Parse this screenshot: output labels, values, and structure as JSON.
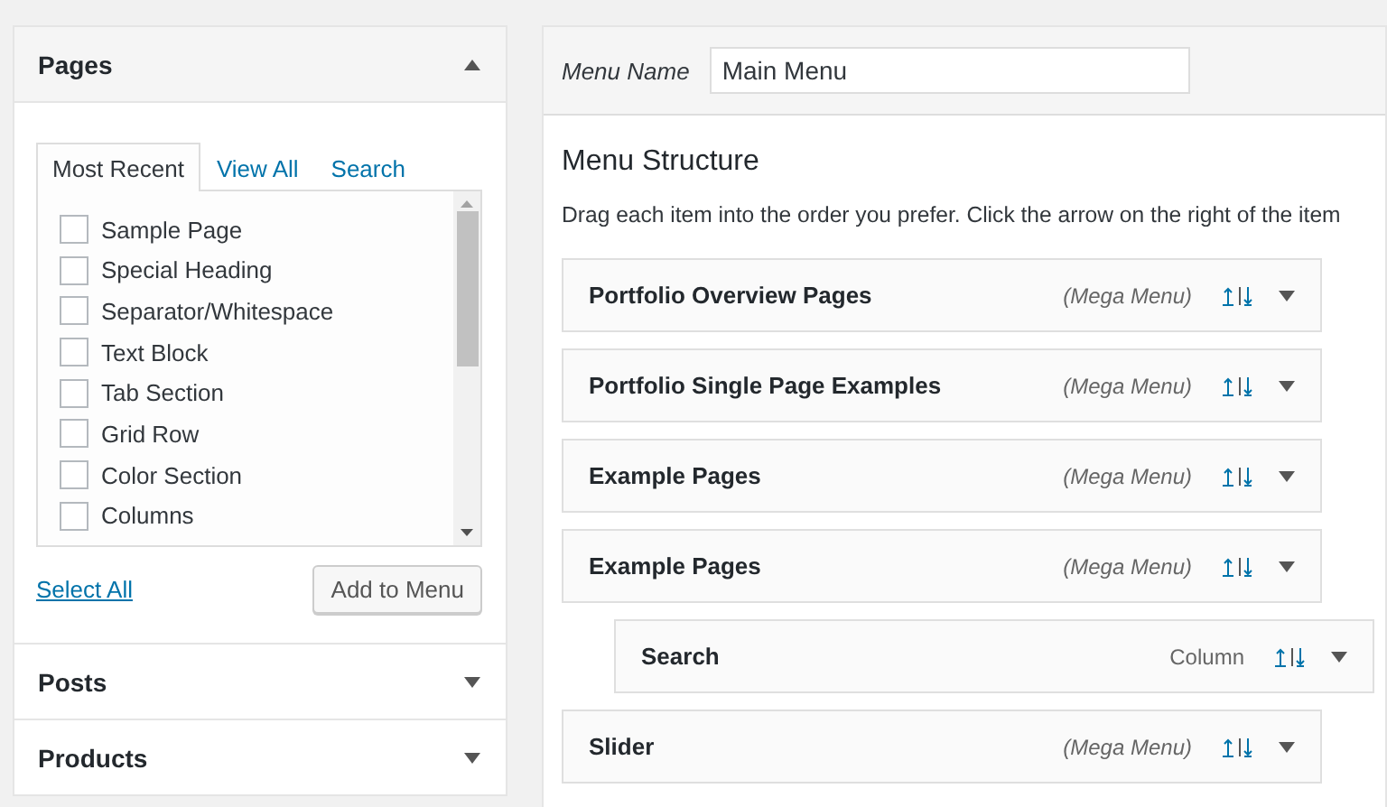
{
  "sidebar": {
    "sections": [
      {
        "title": "Pages",
        "expanded": true,
        "tabs": [
          {
            "label": "Most Recent",
            "selected": true
          },
          {
            "label": "View All",
            "selected": false
          },
          {
            "label": "Search",
            "selected": false
          }
        ],
        "items": [
          {
            "label": "Sample Page",
            "checked": false
          },
          {
            "label": "Special Heading",
            "checked": false
          },
          {
            "label": "Separator/Whitespace",
            "checked": false
          },
          {
            "label": "Text Block",
            "checked": false
          },
          {
            "label": "Tab Section",
            "checked": false
          },
          {
            "label": "Grid Row",
            "checked": false
          },
          {
            "label": "Color Section",
            "checked": false
          },
          {
            "label": "Columns",
            "checked": false
          }
        ],
        "select_all": "Select All",
        "add_button": "Add to Menu"
      },
      {
        "title": "Posts",
        "expanded": false
      },
      {
        "title": "Products",
        "expanded": false
      }
    ]
  },
  "menu": {
    "name_label": "Menu Name",
    "name_value": "Main Menu",
    "heading": "Menu Structure",
    "description": "Drag each item into the order you prefer. Click the arrow on the right of the item",
    "items": [
      {
        "title": "Portfolio Overview Pages",
        "type": "(Mega Menu)",
        "kind": "mega"
      },
      {
        "title": "Portfolio Single Page Examples",
        "type": "(Mega Menu)",
        "kind": "mega"
      },
      {
        "title": "Example Pages",
        "type": "(Mega Menu)",
        "kind": "mega"
      },
      {
        "title": "Example Pages",
        "type": "(Mega Menu)",
        "kind": "mega",
        "children": [
          {
            "title": "Search",
            "type": "Column",
            "kind": "column"
          }
        ]
      },
      {
        "title": "Slider",
        "type": "(Mega Menu)",
        "kind": "mega"
      }
    ]
  }
}
